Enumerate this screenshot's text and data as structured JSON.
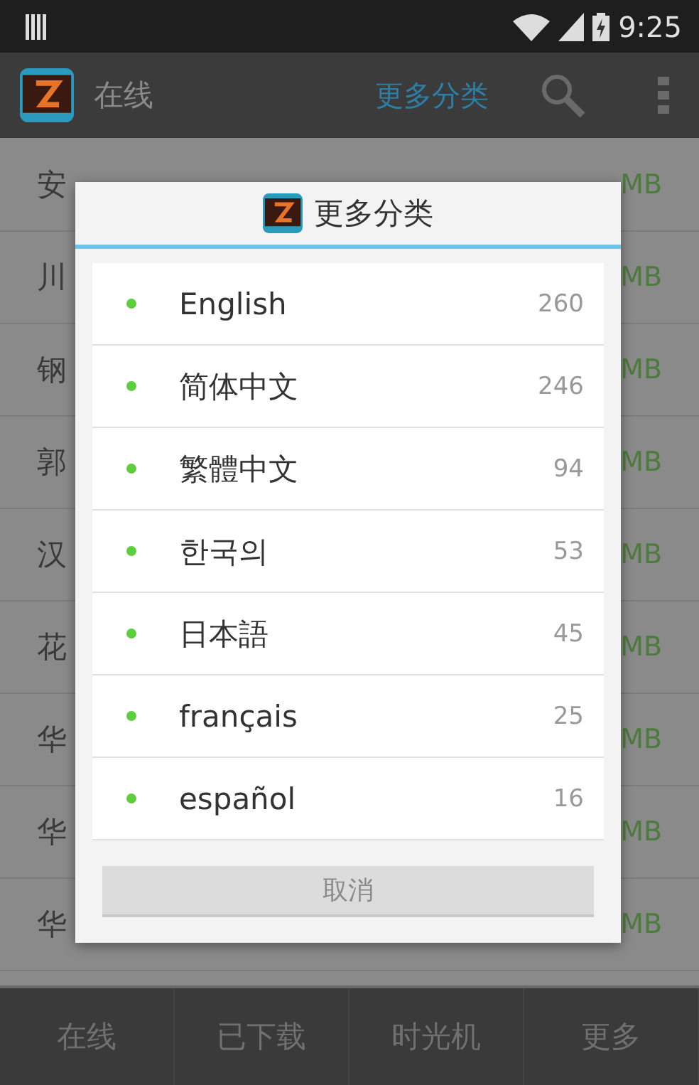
{
  "status_bar": {
    "time": "9:25"
  },
  "action_bar": {
    "title": "在线",
    "category_link": "更多分类"
  },
  "background_list": [
    {
      "name": "安",
      "size": "MB"
    },
    {
      "name": "川",
      "size": "MB"
    },
    {
      "name": "钢",
      "size": "MB"
    },
    {
      "name": "郭",
      "size": "MB"
    },
    {
      "name": "汉",
      "size": "MB"
    },
    {
      "name": "花",
      "size": "MB"
    },
    {
      "name": "华",
      "size": "MB"
    },
    {
      "name": "华",
      "size": "MB"
    },
    {
      "name": "华",
      "size": "MB"
    }
  ],
  "bottom_tabs": [
    "在线",
    "已下载",
    "时光机",
    "更多"
  ],
  "dialog": {
    "title": "更多分类",
    "items": [
      {
        "label": "English",
        "count": "260"
      },
      {
        "label": "简体中文",
        "count": "246"
      },
      {
        "label": "繁體中文",
        "count": "94"
      },
      {
        "label": "한국의",
        "count": "53"
      },
      {
        "label": "日本語",
        "count": "45"
      },
      {
        "label": "français",
        "count": "25"
      },
      {
        "label": "español",
        "count": "16"
      }
    ],
    "cancel": "取消"
  }
}
